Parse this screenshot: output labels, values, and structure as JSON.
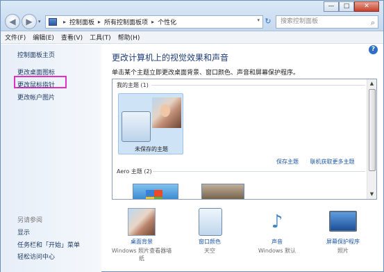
{
  "window": {
    "caption_buttons": {
      "minimize": "—",
      "maximize": "□",
      "close": "✕"
    }
  },
  "nav": {
    "back_glyph": "◀",
    "forward_glyph": "▶",
    "dropdown_glyph": "▾",
    "address": {
      "crumbs": [
        "控制面板",
        "所有控制面板项",
        "个性化"
      ],
      "separator": "▸",
      "dropdown_glyph": "▾"
    },
    "refresh_glyph": "↻",
    "search_placeholder": "搜索控制面板",
    "search_glyph": "⌕"
  },
  "menubar": {
    "items": [
      "文件(F)",
      "编辑(E)",
      "查看(V)",
      "工具(T)",
      "帮助(H)"
    ]
  },
  "sidebar": {
    "home_link": "控制面板主页",
    "links": [
      "更改桌面图标",
      "更改鼠标指针",
      "更改帐户图片"
    ],
    "see_also_label": "另请参阅",
    "see_also_links": [
      "显示",
      "任务栏和「开始」菜单",
      "轻松访问中心"
    ]
  },
  "help_glyph": "?",
  "main": {
    "heading": "更改计算机上的视觉效果和声音",
    "subtext": "单击某个主题立即更改桌面背景、窗口颜色、声音和屏幕保护程序。",
    "my_themes_label": "我的主题 (1)",
    "unsaved_theme_name": "未保存的主题",
    "save_theme_link": "保存主题",
    "get_more_link": "联机获取更多主题",
    "aero_label": "Aero 主题 (2)",
    "scroll_up": "▲",
    "scroll_down": "▼"
  },
  "options": [
    {
      "label": "桌面背景",
      "value": "Windows 照片查看器墙纸",
      "icon": "wallpaper-icon"
    },
    {
      "label": "窗口颜色",
      "value": "天空",
      "icon": "window-color-icon"
    },
    {
      "label": "声音",
      "value": "Windows 默认",
      "icon": "sound-icon",
      "glyph": "♪"
    },
    {
      "label": "屏幕保护程序",
      "value": "照片",
      "icon": "screensaver-icon"
    }
  ]
}
